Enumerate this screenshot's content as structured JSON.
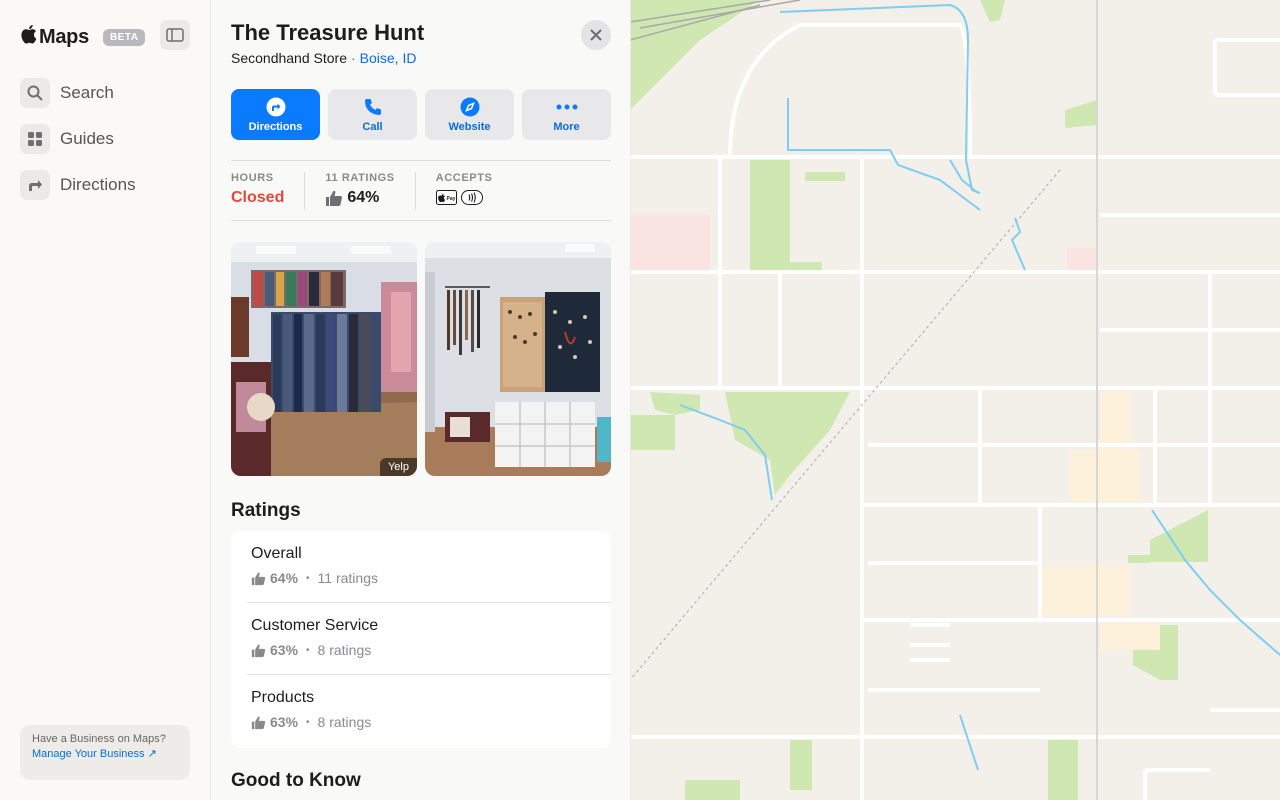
{
  "sidebar": {
    "brand": "Maps",
    "badge": "BETA",
    "nav": [
      {
        "label": "Search",
        "icon": "search-icon"
      },
      {
        "label": "Guides",
        "icon": "guides-icon"
      },
      {
        "label": "Directions",
        "icon": "directions-icon"
      }
    ],
    "business_card": {
      "title": "Have a Business on Maps?",
      "link": "Manage Your Business ↗"
    }
  },
  "place": {
    "name": "The Treasure Hunt",
    "category": "Secondhand Store",
    "separator": "·",
    "location": "Boise, ID",
    "actions": [
      {
        "label": "Directions",
        "icon": "directions-icon",
        "primary": true
      },
      {
        "label": "Call",
        "icon": "phone-icon",
        "primary": false
      },
      {
        "label": "Website",
        "icon": "compass-icon",
        "primary": false
      },
      {
        "label": "More",
        "icon": "more-icon",
        "primary": false
      }
    ],
    "facts": {
      "hours_label": "HOURS",
      "hours_value": "Closed",
      "ratings_label": "11 RATINGS",
      "ratings_value": "64%",
      "accepts_label": "ACCEPTS",
      "accepts_icons": [
        "apple-pay-icon",
        "contactless-icon"
      ]
    },
    "photos": [
      {
        "name": "clothing-racks-photo",
        "credit": "Yelp"
      },
      {
        "name": "accessories-wall-photo",
        "credit": ""
      }
    ],
    "ratings_title": "Ratings",
    "ratings": [
      {
        "name": "Overall",
        "pct": "64%",
        "count": "11 ratings"
      },
      {
        "name": "Customer Service",
        "pct": "63%",
        "count": "8 ratings"
      },
      {
        "name": "Products",
        "pct": "63%",
        "count": "8 ratings"
      }
    ],
    "good_to_know_title": "Good to Know",
    "bullet": "•"
  },
  "colors": {
    "accent": "#0a7aff",
    "link": "#0a6cd6",
    "closed": "#e5483b",
    "map_bg": "#f3f0ea",
    "park": "#cfe7b0",
    "water": "#7fcdf2"
  }
}
